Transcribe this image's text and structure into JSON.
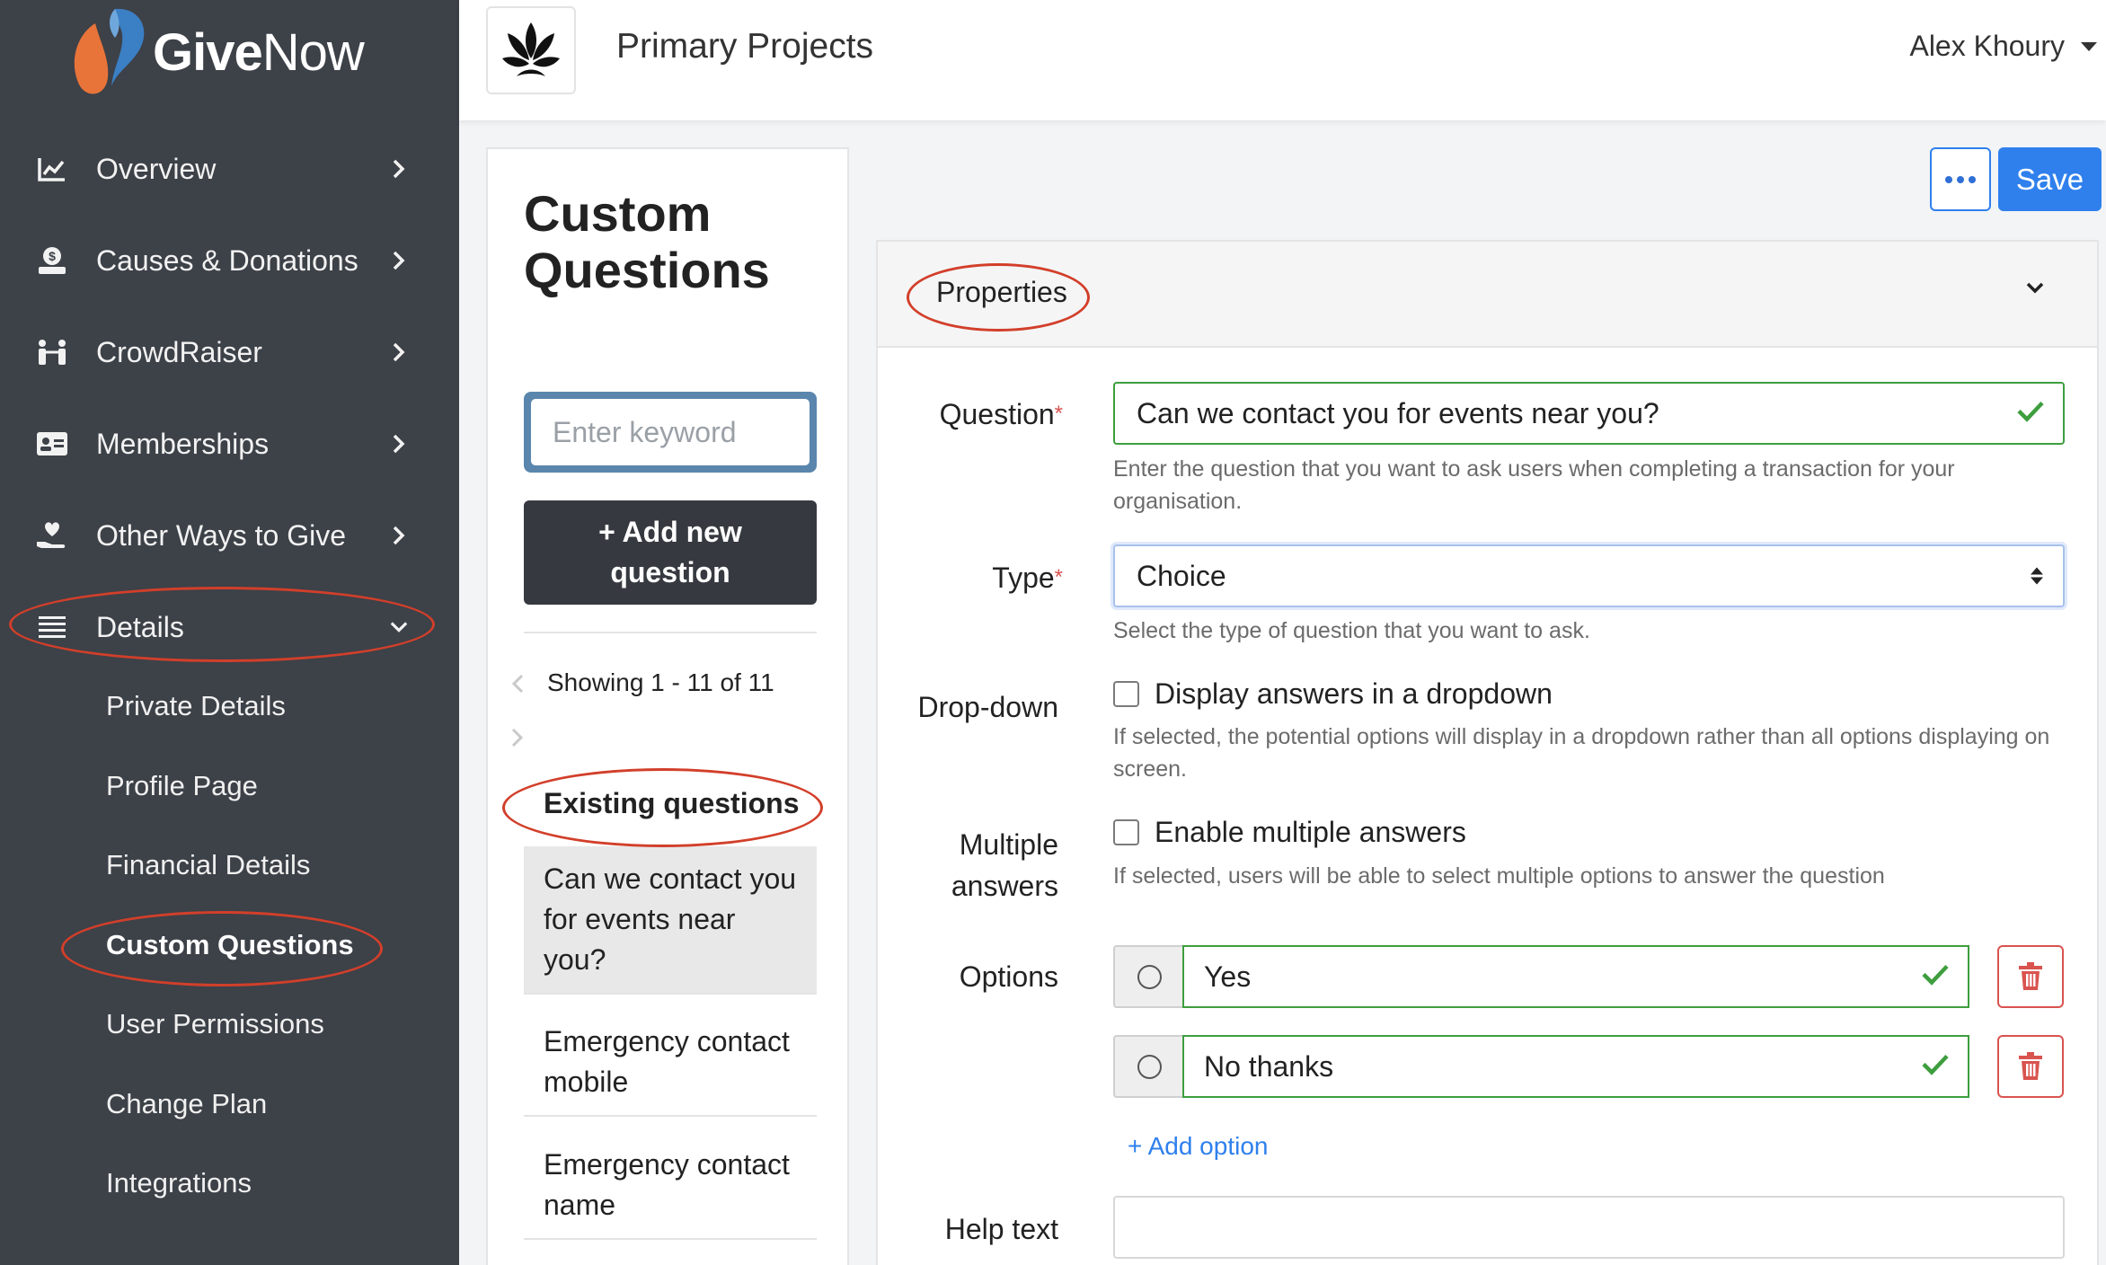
{
  "brand": {
    "name_bold": "Give",
    "name_light": "Now",
    "accent_orange": "#e8743a",
    "accent_blue": "#3b7fc4"
  },
  "sidebar": {
    "items": [
      {
        "label": "Overview",
        "icon": "chart-line-icon"
      },
      {
        "label": "Causes & Donations",
        "icon": "donate-icon"
      },
      {
        "label": "CrowdRaiser",
        "icon": "people-icon"
      },
      {
        "label": "Memberships",
        "icon": "id-card-icon"
      },
      {
        "label": "Other Ways to Give",
        "icon": "hand-heart-icon"
      },
      {
        "label": "Details",
        "icon": "menu-icon"
      }
    ],
    "sub_items": [
      {
        "label": "Private Details"
      },
      {
        "label": "Profile Page"
      },
      {
        "label": "Financial Details"
      },
      {
        "label": "Custom Questions"
      },
      {
        "label": "User Permissions"
      },
      {
        "label": "Change Plan"
      },
      {
        "label": "Integrations"
      }
    ]
  },
  "header": {
    "org_name": "Primary Projects",
    "user_name": "Alex Khoury"
  },
  "list_panel": {
    "title_line1": "Custom",
    "title_line2": "Questions",
    "search_placeholder": "Enter keyword",
    "add_button_line1": "+ Add new",
    "add_button_line2": "question",
    "showing": "Showing 1 - 11 of 11",
    "existing_heading": "Existing questions",
    "questions": [
      "Can we contact you for events near you?",
      "Emergency contact mobile",
      "Emergency contact name"
    ]
  },
  "toolbar": {
    "save_label": "Save"
  },
  "properties": {
    "title": "Properties",
    "question_label": "Question",
    "question_value": "Can we contact you for events near you?",
    "question_help": "Enter the question that you want to ask users when completing a transaction for your organisation.",
    "type_label": "Type",
    "type_value": "Choice",
    "type_help": "Select the type of question that you want to ask.",
    "dropdown_label": "Drop-down",
    "dropdown_checkbox": "Display answers in a dropdown",
    "dropdown_help": "If selected, the potential options will display in a dropdown rather than all options displaying on screen.",
    "multiple_label_line1": "Multiple",
    "multiple_label_line2": "answers",
    "multiple_checkbox": "Enable multiple answers",
    "multiple_help": "If selected, users will be able to select multiple options to answer the question",
    "options_label": "Options",
    "options": [
      "Yes",
      "No thanks"
    ],
    "add_option": "+ Add option",
    "help_text_label": "Help text",
    "help_text_value": ""
  }
}
